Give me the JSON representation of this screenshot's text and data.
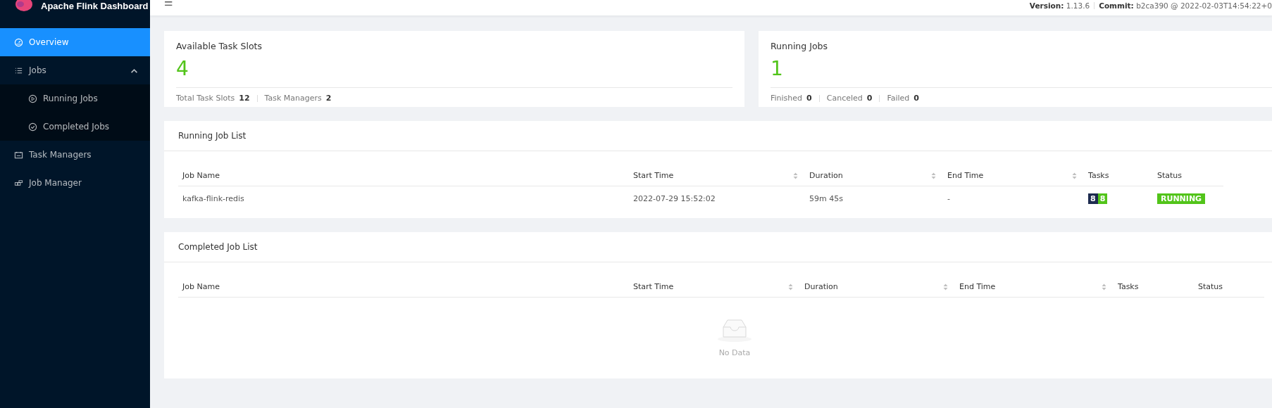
{
  "sidebar": {
    "brand": "Apache Flink Dashboard",
    "items": [
      {
        "label": "Overview",
        "kind": "gauge",
        "selected": true
      },
      {
        "label": "Jobs",
        "kind": "list",
        "selected": false,
        "expanded": true,
        "children": [
          {
            "label": "Running Jobs",
            "kind": "play",
            "selected": false
          },
          {
            "label": "Completed Jobs",
            "kind": "check",
            "selected": false
          }
        ]
      },
      {
        "label": "Task Managers",
        "kind": "calendar",
        "selected": false
      },
      {
        "label": "Job Manager",
        "kind": "blocks",
        "selected": false
      }
    ]
  },
  "header": {
    "menu_icon": "☰",
    "version_label": "Version:",
    "version": "1.13.6",
    "commit_label": "Commit:",
    "commit": "b2ca390 @ 2022-02-03T14:54:22+0"
  },
  "stat_cards": [
    {
      "title": "Available Task Slots",
      "value": "4",
      "details": [
        {
          "label": "Total Task Slots",
          "value": "12"
        },
        {
          "label": "Task Managers",
          "value": "2"
        }
      ]
    },
    {
      "title": "Running Jobs",
      "value": "1",
      "details": [
        {
          "label": "Finished",
          "value": "0"
        },
        {
          "label": "Canceled",
          "value": "0"
        },
        {
          "label": "Failed",
          "value": "0"
        }
      ]
    }
  ],
  "job_tables": [
    {
      "title": "Running Job List",
      "columns": [
        {
          "label": "Job Name",
          "sortable": false
        },
        {
          "label": "Start Time",
          "sortable": true
        },
        {
          "label": "Duration",
          "sortable": true
        },
        {
          "label": "End Time",
          "sortable": true
        },
        {
          "label": "Tasks",
          "sortable": false
        },
        {
          "label": "Status",
          "sortable": false
        }
      ],
      "rows": [
        {
          "job_name": "kafka-flink-redis",
          "start_time": "2022-07-29 15:52:02",
          "duration": "59m 45s",
          "end_time": "-",
          "tasks": [
            {
              "count": "8",
              "color": "#1d2b4f"
            },
            {
              "count": "8",
              "color": "#52c41a"
            }
          ],
          "status": "RUNNING"
        }
      ]
    },
    {
      "title": "Completed Job List",
      "columns": [
        {
          "label": "Job Name",
          "sortable": false
        },
        {
          "label": "Start Time",
          "sortable": true
        },
        {
          "label": "Duration",
          "sortable": true
        },
        {
          "label": "End Time",
          "sortable": true
        },
        {
          "label": "Tasks",
          "sortable": false
        },
        {
          "label": "Status",
          "sortable": false
        }
      ],
      "empty_text": "No Data"
    }
  ]
}
